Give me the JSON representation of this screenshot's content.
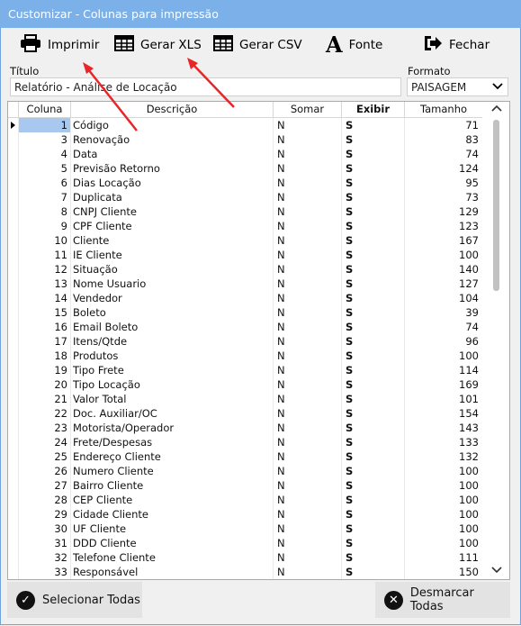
{
  "window": {
    "title": "Customizar - Colunas para impressão"
  },
  "toolbar": {
    "print": "Imprimir",
    "xls": "Gerar XLS",
    "csv": "Gerar CSV",
    "font": "Fonte",
    "close": "Fechar"
  },
  "form": {
    "title_label": "Título",
    "title_value": "Relatório - Análise de Locação",
    "format_label": "Formato",
    "format_value": "PAISAGEM"
  },
  "table": {
    "headers": [
      "Coluna",
      "Descrição",
      "Somar",
      "Exibir",
      "Tamanho"
    ],
    "rows": [
      {
        "col": "1",
        "desc": "Código",
        "som": "N",
        "exi": "S",
        "tam": "71"
      },
      {
        "col": "3",
        "desc": "Renovação",
        "som": "N",
        "exi": "S",
        "tam": "83"
      },
      {
        "col": "4",
        "desc": "Data",
        "som": "N",
        "exi": "S",
        "tam": "74"
      },
      {
        "col": "5",
        "desc": "Previsão Retorno",
        "som": "N",
        "exi": "S",
        "tam": "124"
      },
      {
        "col": "6",
        "desc": "Dias Locação",
        "som": "N",
        "exi": "S",
        "tam": "95"
      },
      {
        "col": "7",
        "desc": "Duplicata",
        "som": "N",
        "exi": "S",
        "tam": "73"
      },
      {
        "col": "8",
        "desc": "CNPJ Cliente",
        "som": "N",
        "exi": "S",
        "tam": "129"
      },
      {
        "col": "9",
        "desc": "CPF Cliente",
        "som": "N",
        "exi": "S",
        "tam": "123"
      },
      {
        "col": "10",
        "desc": "Cliente",
        "som": "N",
        "exi": "S",
        "tam": "167"
      },
      {
        "col": "11",
        "desc": "IE Cliente",
        "som": "N",
        "exi": "S",
        "tam": "100"
      },
      {
        "col": "12",
        "desc": "Situação",
        "som": "N",
        "exi": "S",
        "tam": "140"
      },
      {
        "col": "13",
        "desc": "Nome Usuario",
        "som": "N",
        "exi": "S",
        "tam": "127"
      },
      {
        "col": "14",
        "desc": "Vendedor",
        "som": "N",
        "exi": "S",
        "tam": "104"
      },
      {
        "col": "15",
        "desc": "Boleto",
        "som": "N",
        "exi": "S",
        "tam": "39"
      },
      {
        "col": "16",
        "desc": "Email Boleto",
        "som": "N",
        "exi": "S",
        "tam": "74"
      },
      {
        "col": "17",
        "desc": "Itens/Qtde",
        "som": "N",
        "exi": "S",
        "tam": "96"
      },
      {
        "col": "18",
        "desc": "Produtos",
        "som": "N",
        "exi": "S",
        "tam": "100"
      },
      {
        "col": "19",
        "desc": "Tipo Frete",
        "som": "N",
        "exi": "S",
        "tam": "114"
      },
      {
        "col": "20",
        "desc": "Tipo Locação",
        "som": "N",
        "exi": "S",
        "tam": "169"
      },
      {
        "col": "21",
        "desc": "Valor Total",
        "som": "N",
        "exi": "S",
        "tam": "101"
      },
      {
        "col": "22",
        "desc": "Doc. Auxiliar/OC",
        "som": "N",
        "exi": "S",
        "tam": "154"
      },
      {
        "col": "23",
        "desc": "Motorista/Operador",
        "som": "N",
        "exi": "S",
        "tam": "143"
      },
      {
        "col": "24",
        "desc": "Frete/Despesas",
        "som": "N",
        "exi": "S",
        "tam": "133"
      },
      {
        "col": "25",
        "desc": "Endereço Cliente",
        "som": "N",
        "exi": "S",
        "tam": "132"
      },
      {
        "col": "26",
        "desc": "Numero Cliente",
        "som": "N",
        "exi": "S",
        "tam": "100"
      },
      {
        "col": "27",
        "desc": "Bairro Cliente",
        "som": "N",
        "exi": "S",
        "tam": "100"
      },
      {
        "col": "28",
        "desc": "CEP Cliente",
        "som": "N",
        "exi": "S",
        "tam": "100"
      },
      {
        "col": "29",
        "desc": "Cidade Cliente",
        "som": "N",
        "exi": "S",
        "tam": "100"
      },
      {
        "col": "30",
        "desc": "UF Cliente",
        "som": "N",
        "exi": "S",
        "tam": "100"
      },
      {
        "col": "31",
        "desc": "DDD Cliente",
        "som": "N",
        "exi": "S",
        "tam": "100"
      },
      {
        "col": "32",
        "desc": "Telefone Cliente",
        "som": "N",
        "exi": "S",
        "tam": "111"
      },
      {
        "col": "33",
        "desc": "Responsável",
        "som": "N",
        "exi": "S",
        "tam": "150"
      }
    ]
  },
  "footer": {
    "select_all": "Selecionar Todas",
    "deselect_all": "Desmarcar Todas"
  },
  "colors": {
    "titlebar": "#7bb0e8",
    "selection": "#a8c8f0",
    "annotation_arrow": "#e8262a"
  },
  "icons": [
    "printer-icon",
    "table-icon",
    "font-icon",
    "exit-icon",
    "check-circle-icon",
    "x-circle-icon",
    "chevron-down-icon"
  ]
}
